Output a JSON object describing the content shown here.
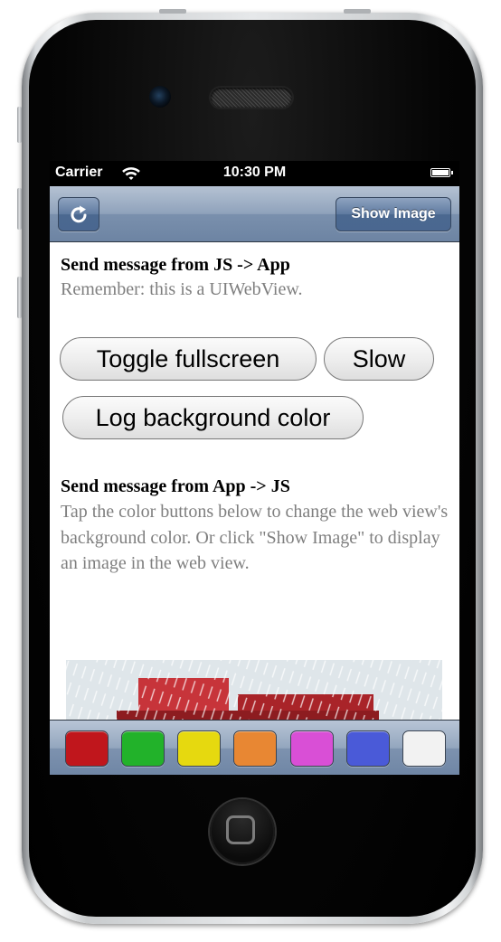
{
  "statusbar": {
    "carrier": "Carrier",
    "time": "10:30 PM"
  },
  "navbar": {
    "refresh_icon": "refresh-icon",
    "show_image_label": "Show Image"
  },
  "content": {
    "section1_heading": "Send message from JS -> App",
    "section1_text": "Remember: this is a UIWebView.",
    "buttons": {
      "toggle_fullscreen": "Toggle fullscreen",
      "slow": "Slow",
      "log_background": "Log background color"
    },
    "section2_heading": "Send message from App -> JS",
    "section2_text": "Tap the color buttons below to change the web view's background color. Or click \"Show Image\" to display an image in the web view."
  },
  "toolbar": {
    "swatches": [
      {
        "name": "red",
        "color": "#c0161c"
      },
      {
        "name": "green",
        "color": "#22b22a"
      },
      {
        "name": "yellow",
        "color": "#e6d90f"
      },
      {
        "name": "orange",
        "color": "#e88733"
      },
      {
        "name": "magenta",
        "color": "#d94fd6"
      },
      {
        "name": "blue",
        "color": "#4a5ad8"
      },
      {
        "name": "white",
        "color": "#f2f2f2"
      }
    ]
  }
}
